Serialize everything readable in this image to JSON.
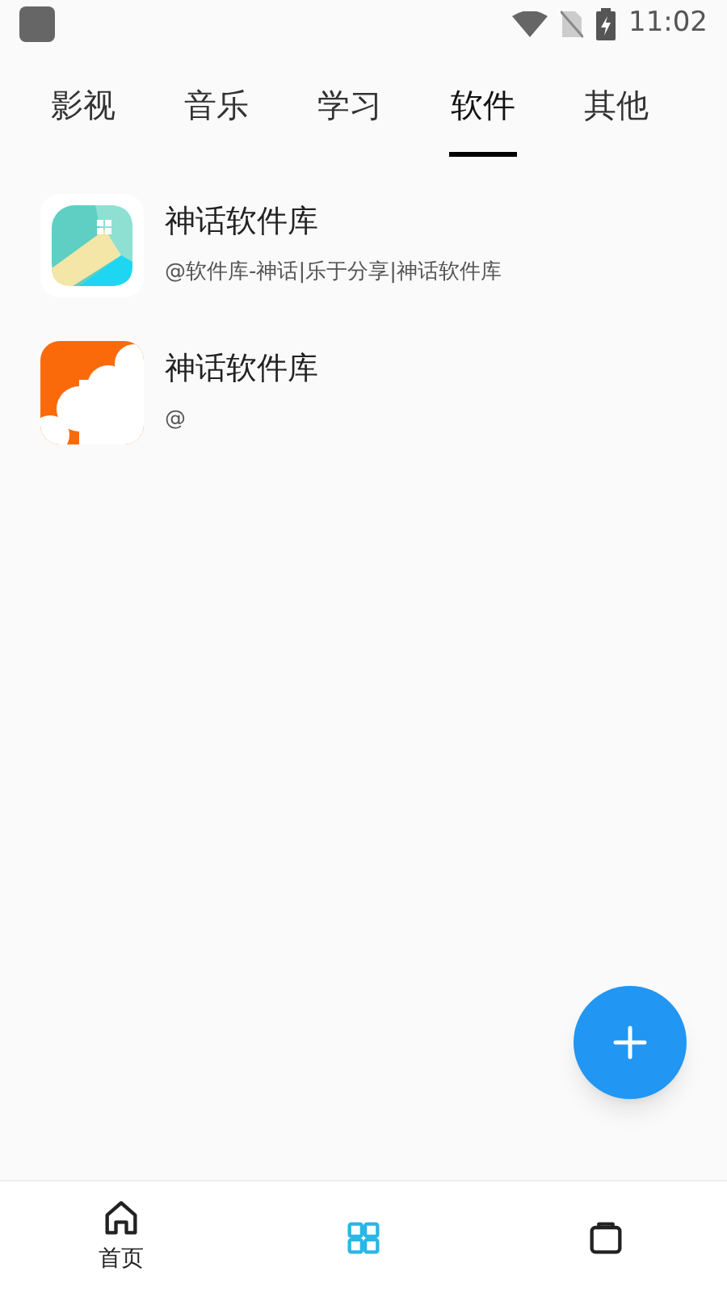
{
  "status_bar": {
    "time": "11:02"
  },
  "tabs": [
    {
      "label": "影视",
      "selected": false
    },
    {
      "label": "音乐",
      "selected": false
    },
    {
      "label": "学习",
      "selected": false
    },
    {
      "label": "软件",
      "selected": true
    },
    {
      "label": "其他",
      "selected": false
    }
  ],
  "items": [
    {
      "title": "神话软件库",
      "subtitle": "@软件库-神话|乐于分享|神话软件库",
      "kind": "teal"
    },
    {
      "title": "神话软件库",
      "subtitle": "@",
      "kind": "orange"
    }
  ],
  "bottom_nav": [
    {
      "label": "首页",
      "kind": "home",
      "selected": false
    },
    {
      "kind": "grid",
      "selected": true
    },
    {
      "kind": "box",
      "selected": false
    }
  ]
}
